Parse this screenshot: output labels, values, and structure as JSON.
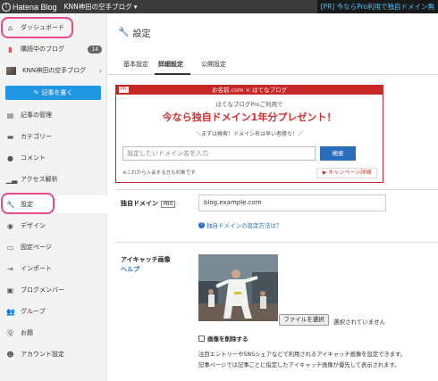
{
  "topbar": {
    "logo_text": "Hatena Blog",
    "blog_name": "KNN神田の空手ブログ",
    "promo": "[PR] 今ならPro利用で独自ドメイン無"
  },
  "sidebar": {
    "items": [
      {
        "label": "ダッシュボード"
      },
      {
        "label": "購読中のブログ",
        "badge": "14"
      },
      {
        "label": "KNN神田の空手ブログ"
      },
      {
        "label": "記事の管理"
      },
      {
        "label": "カテゴリー"
      },
      {
        "label": "コメント"
      },
      {
        "label": "アクセス解析"
      },
      {
        "label": "設定"
      },
      {
        "label": "デザイン"
      },
      {
        "label": "固定ページ"
      },
      {
        "label": "インポート"
      },
      {
        "label": "ブログメンバー"
      },
      {
        "label": "グループ"
      },
      {
        "label": "お題"
      },
      {
        "label": "アカウント設定"
      }
    ],
    "write_button": "記事を書く"
  },
  "main": {
    "title": "設定",
    "tabs": [
      {
        "label": "基本設定"
      },
      {
        "label": "詳細設定"
      },
      {
        "label": "公開設定"
      }
    ],
    "banner": {
      "header": "お名前.com × はてなブログ",
      "pr": "PR",
      "sub": "はてなブログProご利用で",
      "headline": "今なら独自ドメイン1年分プレゼント！",
      "note": "＼まずは検索！ドメイン名は早い者勝ち！／",
      "input_placeholder": "設定したいドメイン名を入力",
      "search_button": "検索",
      "footnote": "※これから入会する方も対象です",
      "campaign_link": "▶ キャンペーン詳細"
    },
    "domain": {
      "label": "独自ドメイン",
      "pro": "PRO",
      "value": "blog.example.com",
      "help": "独自ドメインの設定方法は？"
    },
    "eyecatch": {
      "label": "アイキャッチ画像",
      "help": "ヘルプ",
      "file_button": "ファイルを選択",
      "file_status": "選択されていません",
      "delete_label": "画像を削除する",
      "desc1": "注目エントリーやSNSシェアなどで利用されるアイキャッチ画像を設定できます。",
      "desc2": "記事ページでは記事ごとに指定したアイキャッチ画像が優先して表示されます。"
    }
  },
  "colors": {
    "accent": "#2196e3",
    "highlight": "#e84a8a",
    "banner_red": "#c62828"
  }
}
